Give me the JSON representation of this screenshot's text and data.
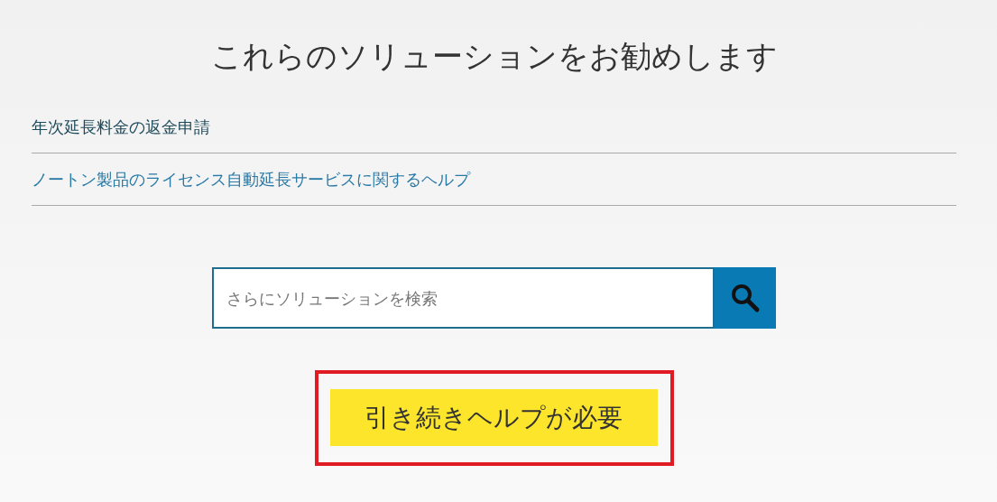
{
  "heading": "これらのソリューションをお勧めします",
  "links": [
    {
      "label": "年次延長料金の返金申請",
      "visited": true
    },
    {
      "label": "ノートン製品のライセンス自動延長サービスに関するヘルプ",
      "visited": false
    }
  ],
  "search": {
    "placeholder": "さらにソリューションを検索"
  },
  "help_button": {
    "label": "引き続きヘルプが必要",
    "highlighted": true
  }
}
